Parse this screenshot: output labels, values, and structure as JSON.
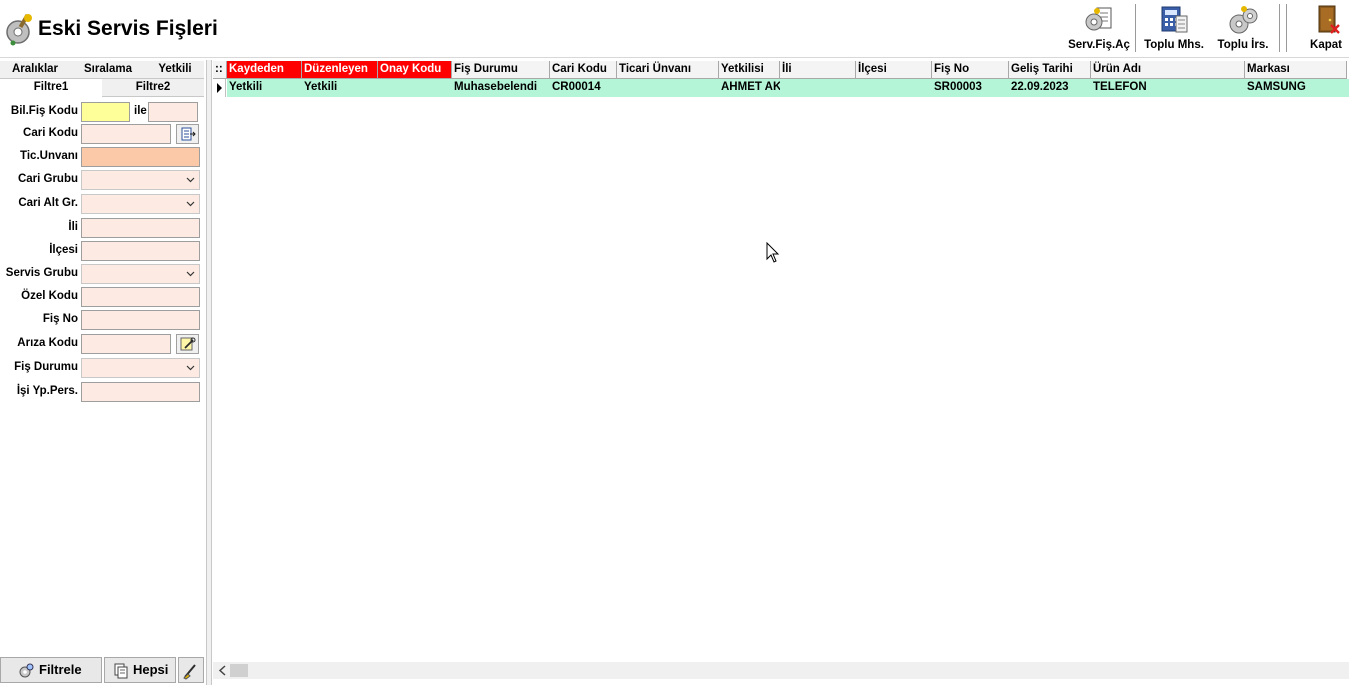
{
  "window": {
    "title": "Eski Servis Fişleri"
  },
  "toolbar": {
    "buttons": [
      {
        "label": "Serv.Fiş.Aç",
        "icon": "service-open-icon"
      },
      {
        "label": "Toplu Mhs.",
        "icon": "bulk-accounting-icon"
      },
      {
        "label": "Toplu İrs.",
        "icon": "bulk-waybill-icon"
      },
      {
        "label": "Kapat",
        "icon": "close-door-icon"
      }
    ]
  },
  "left_panel": {
    "tabs_row1": [
      "Aralıklar",
      "Sıralama",
      "Yetkili"
    ],
    "tabs_row2": [
      "Filtre1",
      "Filtre2"
    ],
    "active_tab": "Filtre1",
    "ile_label": "ile",
    "fields": [
      {
        "label": "Bil.Fiş Kodu",
        "value": ""
      },
      {
        "label": "Cari Kodu",
        "value": ""
      },
      {
        "label": "Tic.Unvanı",
        "value": ""
      },
      {
        "label": "Cari Grubu",
        "value": ""
      },
      {
        "label": "Cari Alt Gr.",
        "value": ""
      },
      {
        "label": "İli",
        "value": ""
      },
      {
        "label": "İlçesi",
        "value": ""
      },
      {
        "label": "Servis Grubu",
        "value": ""
      },
      {
        "label": "Özel Kodu",
        "value": ""
      },
      {
        "label": "Fiş No",
        "value": ""
      },
      {
        "label": "Arıza Kodu",
        "value": ""
      },
      {
        "label": "Fiş Durumu",
        "value": ""
      },
      {
        "label": "İşi Yp.Pers.",
        "value": ""
      }
    ],
    "ellipsis_label": "...",
    "bottom_buttons": {
      "filter": "Filtrele",
      "all": "Hepsi"
    }
  },
  "grid": {
    "indicator_header": "::",
    "columns": [
      {
        "label": "Kaydeden",
        "highlight": true
      },
      {
        "label": "Düzenleyen",
        "highlight": true
      },
      {
        "label": "Onay Kodu",
        "highlight": true
      },
      {
        "label": "Fiş Durumu",
        "highlight": false
      },
      {
        "label": "Cari Kodu",
        "highlight": false
      },
      {
        "label": "Ticari Ünvanı",
        "highlight": false
      },
      {
        "label": "Yetkilisi",
        "highlight": false
      },
      {
        "label": "İli",
        "highlight": false
      },
      {
        "label": "İlçesi",
        "highlight": false
      },
      {
        "label": "Fiş No",
        "highlight": false
      },
      {
        "label": "Geliş Tarihi",
        "highlight": false
      },
      {
        "label": "Ürün Adı",
        "highlight": false
      },
      {
        "label": "Markası",
        "highlight": false
      }
    ],
    "rows": [
      [
        "Yetkili",
        "Yetkili",
        "",
        "Muhasebelendi",
        "CR00014",
        "",
        "AHMET AK",
        "",
        "",
        "SR00003",
        "22.09.2023",
        "TELEFON",
        "SAMSUNG"
      ]
    ]
  },
  "colors": {
    "highlight_header": "#ff0000",
    "row_selected": "#b3f5d6",
    "input_bg": "#fdebe3",
    "input_focus": "#ffff99"
  }
}
